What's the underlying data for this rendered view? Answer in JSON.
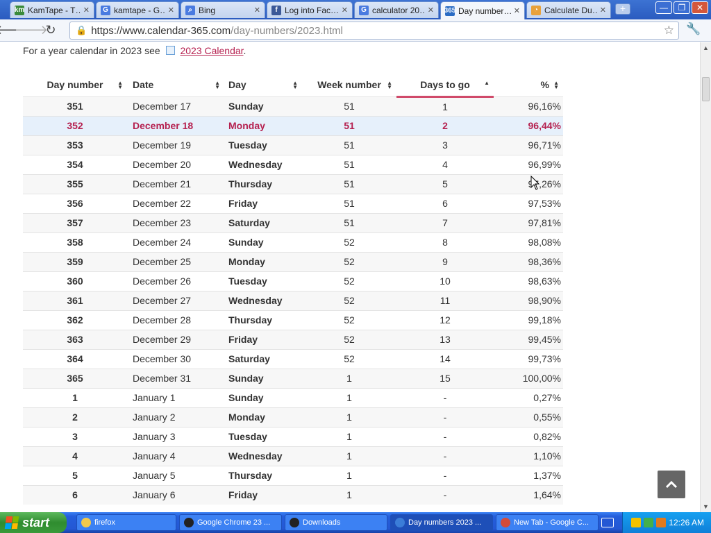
{
  "browser": {
    "tabs": [
      {
        "label": "KamTape - T…",
        "icon": "kamtape-icon",
        "icon_text": "km",
        "active": false
      },
      {
        "label": "kamtape - G…",
        "icon": "google-icon",
        "icon_text": "G",
        "active": false
      },
      {
        "label": "Bing",
        "icon": "bing-search-icon",
        "icon_text": "⌕",
        "active": false
      },
      {
        "label": "Log into Fac…",
        "icon": "facebook-icon",
        "icon_text": "f",
        "active": false
      },
      {
        "label": "calculator 20…",
        "icon": "google-icon",
        "icon_text": "G",
        "active": false
      },
      {
        "label": "Day number…",
        "icon": "calendar365-icon",
        "icon_text": "365",
        "active": true
      },
      {
        "label": "Calculate Du…",
        "icon": "timeanddate-icon",
        "icon_text": "◔",
        "active": false
      }
    ],
    "url_host": "https://www.calendar-365.com",
    "url_path": "/day-numbers/2023.html"
  },
  "page": {
    "intro_text": "For a year calendar in 2023 see",
    "intro_link": "2023 Calendar",
    "intro_end": "."
  },
  "table": {
    "headers": [
      "Day number",
      "Date",
      "Day",
      "Week number",
      "Days to go",
      "%"
    ],
    "sorted_column": "Days to go",
    "rows": [
      {
        "num": "351",
        "date": "December 17",
        "day": "Sunday",
        "week": "51",
        "togo": "1",
        "pct": "96,16%"
      },
      {
        "num": "352",
        "date": "December 18",
        "day": "Monday",
        "week": "51",
        "togo": "2",
        "pct": "96,44%",
        "highlight": true
      },
      {
        "num": "353",
        "date": "December 19",
        "day": "Tuesday",
        "week": "51",
        "togo": "3",
        "pct": "96,71%"
      },
      {
        "num": "354",
        "date": "December 20",
        "day": "Wednesday",
        "week": "51",
        "togo": "4",
        "pct": "96,99%"
      },
      {
        "num": "355",
        "date": "December 21",
        "day": "Thursday",
        "week": "51",
        "togo": "5",
        "pct": "97,26%"
      },
      {
        "num": "356",
        "date": "December 22",
        "day": "Friday",
        "week": "51",
        "togo": "6",
        "pct": "97,53%"
      },
      {
        "num": "357",
        "date": "December 23",
        "day": "Saturday",
        "week": "51",
        "togo": "7",
        "pct": "97,81%"
      },
      {
        "num": "358",
        "date": "December 24",
        "day": "Sunday",
        "week": "52",
        "togo": "8",
        "pct": "98,08%"
      },
      {
        "num": "359",
        "date": "December 25",
        "day": "Monday",
        "week": "52",
        "togo": "9",
        "pct": "98,36%"
      },
      {
        "num": "360",
        "date": "December 26",
        "day": "Tuesday",
        "week": "52",
        "togo": "10",
        "pct": "98,63%"
      },
      {
        "num": "361",
        "date": "December 27",
        "day": "Wednesday",
        "week": "52",
        "togo": "11",
        "pct": "98,90%"
      },
      {
        "num": "362",
        "date": "December 28",
        "day": "Thursday",
        "week": "52",
        "togo": "12",
        "pct": "99,18%"
      },
      {
        "num": "363",
        "date": "December 29",
        "day": "Friday",
        "week": "52",
        "togo": "13",
        "pct": "99,45%"
      },
      {
        "num": "364",
        "date": "December 30",
        "day": "Saturday",
        "week": "52",
        "togo": "14",
        "pct": "99,73%"
      },
      {
        "num": "365",
        "date": "December 31",
        "day": "Sunday",
        "week": "1",
        "togo": "15",
        "pct": "100,00%"
      },
      {
        "num": "1",
        "date": "January 1",
        "day": "Sunday",
        "week": "1",
        "togo": "-",
        "pct": "0,27%"
      },
      {
        "num": "2",
        "date": "January 2",
        "day": "Monday",
        "week": "1",
        "togo": "-",
        "pct": "0,55%"
      },
      {
        "num": "3",
        "date": "January 3",
        "day": "Tuesday",
        "week": "1",
        "togo": "-",
        "pct": "0,82%"
      },
      {
        "num": "4",
        "date": "January 4",
        "day": "Wednesday",
        "week": "1",
        "togo": "-",
        "pct": "1,10%"
      },
      {
        "num": "5",
        "date": "January 5",
        "day": "Thursday",
        "week": "1",
        "togo": "-",
        "pct": "1,37%"
      },
      {
        "num": "6",
        "date": "January 6",
        "day": "Friday",
        "week": "1",
        "togo": "-",
        "pct": "1,64%"
      }
    ]
  },
  "taskbar": {
    "start_label": "start",
    "tasks": [
      {
        "label": "firefox",
        "icon": "folder-icon",
        "color": "#f3c94a",
        "active": false
      },
      {
        "label": "Google Chrome 23 ...",
        "icon": "obs-icon",
        "color": "#222222",
        "active": false
      },
      {
        "label": "Downloads",
        "icon": "obs-icon",
        "color": "#222222",
        "active": false
      },
      {
        "label": "Day numbers 2023 ...",
        "icon": "calendar365-icon",
        "color": "#3b7dd8",
        "active": true
      },
      {
        "label": "New Tab - Google C...",
        "icon": "chrome-icon",
        "color": "#d44b3a",
        "active": false
      }
    ],
    "clock": "12:26 AM"
  },
  "colors": {
    "accent": "#b5204f",
    "highlight_row": "#e6f0fb",
    "sort_underline": "#d04a6a"
  }
}
